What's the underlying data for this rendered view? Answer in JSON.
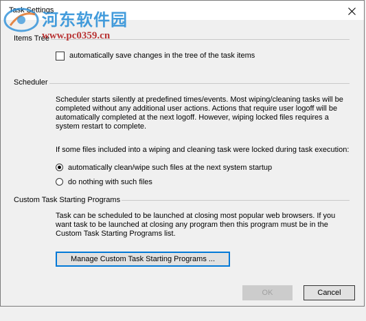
{
  "window": {
    "title": "Task Settings",
    "close_glyph": "✕"
  },
  "watermark": {
    "text_cn": "河东软件园",
    "url": "www.pc0359.cn"
  },
  "items_tree": {
    "label": "Items Tree",
    "autosave": {
      "label": "automatically save changes in the tree of the task items",
      "checked": false
    }
  },
  "scheduler": {
    "label": "Scheduler",
    "description": "Scheduler starts silently at predefined times/events. Most wiping/cleaning tasks will be completed without any additional user actions. Actions that require user logoff will be automatically completed at the next logoff. However, wiping locked files requires a system restart to complete.",
    "locked_prompt": "If some files included into a wiping and cleaning task were locked during task execution:",
    "options": [
      {
        "label": "automatically clean/wipe such files at the next system startup",
        "checked": true
      },
      {
        "label": "do nothing with such files",
        "checked": false
      }
    ]
  },
  "custom_programs": {
    "label": "Custom Task Starting Programs",
    "description": "Task can be scheduled to be launched at closing most popular web browsers. If you want task to be launched at closing any program then this program must be in the Custom Task Starting Programs list.",
    "manage_button": "Manage Custom Task Starting Programs ..."
  },
  "footer": {
    "ok_label": "OK",
    "cancel_label": "Cancel"
  },
  "colors": {
    "focus_border": "#0078d7",
    "watermark_blue": "#2a8fd8",
    "watermark_red": "#b22020"
  }
}
